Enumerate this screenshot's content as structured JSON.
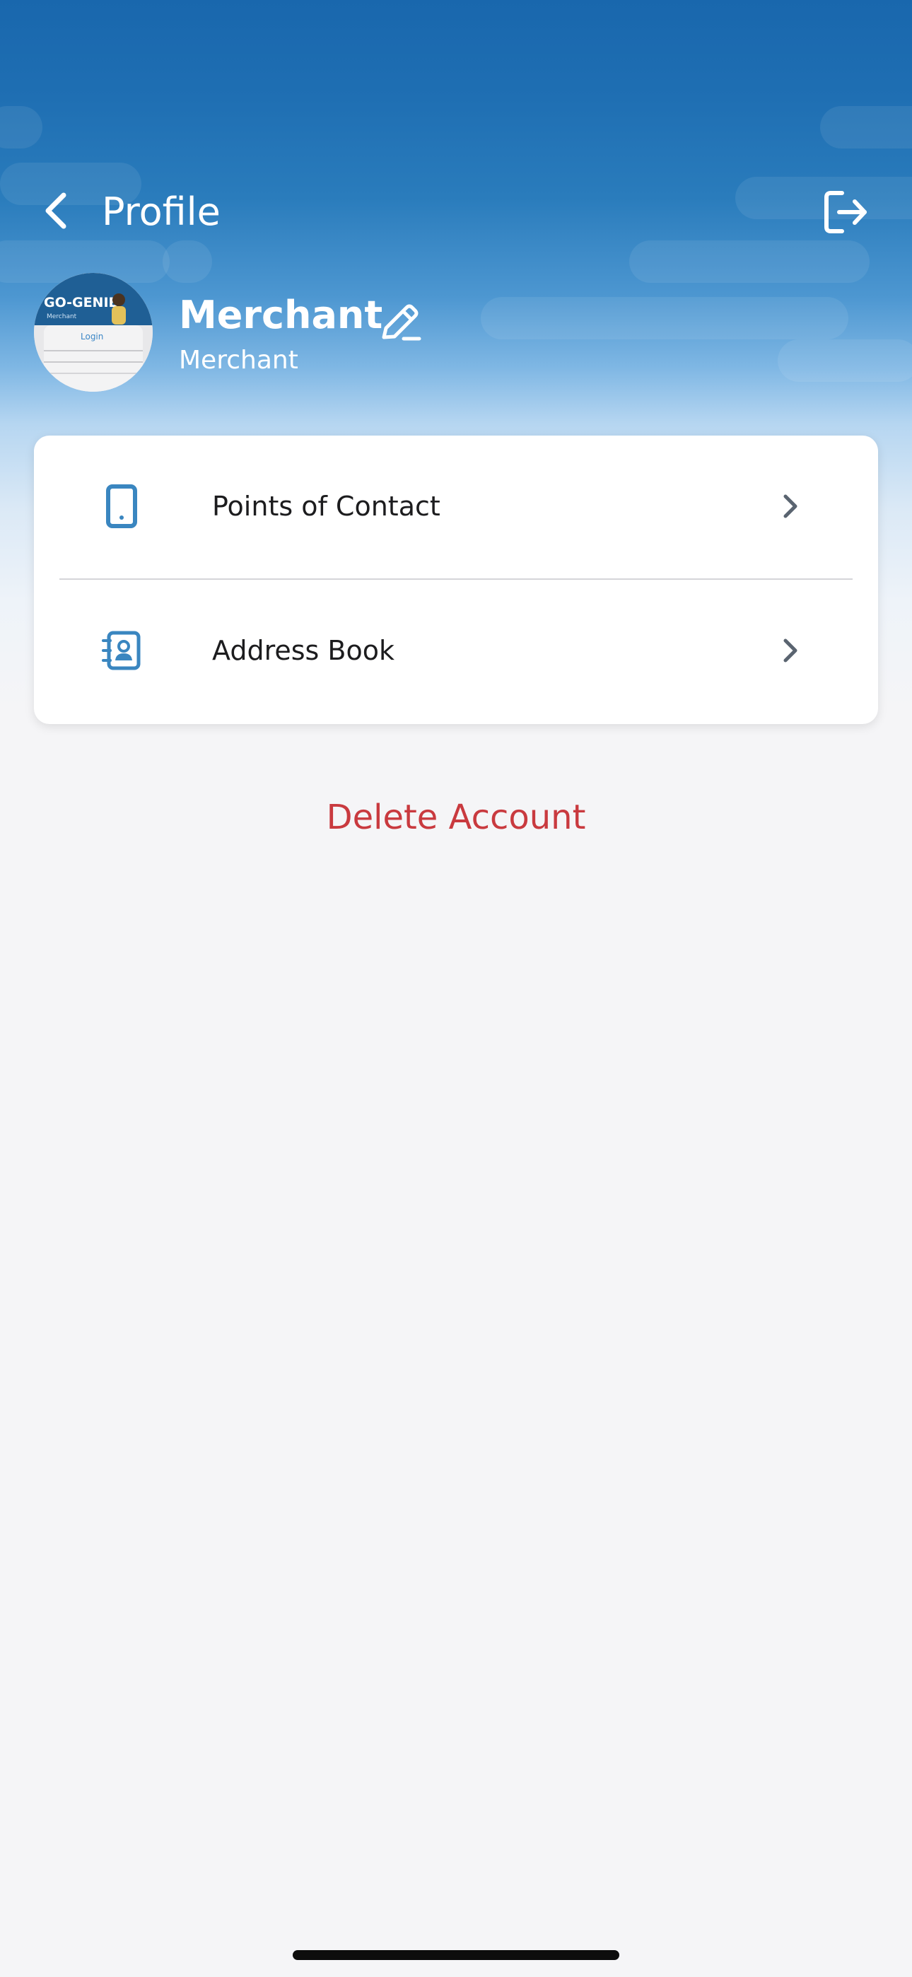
{
  "header": {
    "title": "Profile",
    "back_icon": "chevron-left-icon",
    "logout_icon": "logout-icon"
  },
  "profile": {
    "name": "Merchant",
    "role": "Merchant",
    "edit_icon": "pencil-edit-icon",
    "avatar_text": {
      "brand": "GO-GENIE",
      "sub": "Merchant",
      "login": "Login"
    }
  },
  "menu": {
    "items": [
      {
        "label": "Points of Contact",
        "icon": "phone-icon"
      },
      {
        "label": "Address Book",
        "icon": "address-book-icon"
      }
    ]
  },
  "actions": {
    "delete_label": "Delete Account"
  },
  "colors": {
    "header_blue": "#1967ad",
    "icon_blue": "#3a86c0",
    "danger_red": "#c93a3f",
    "background": "#f5f5f7"
  }
}
